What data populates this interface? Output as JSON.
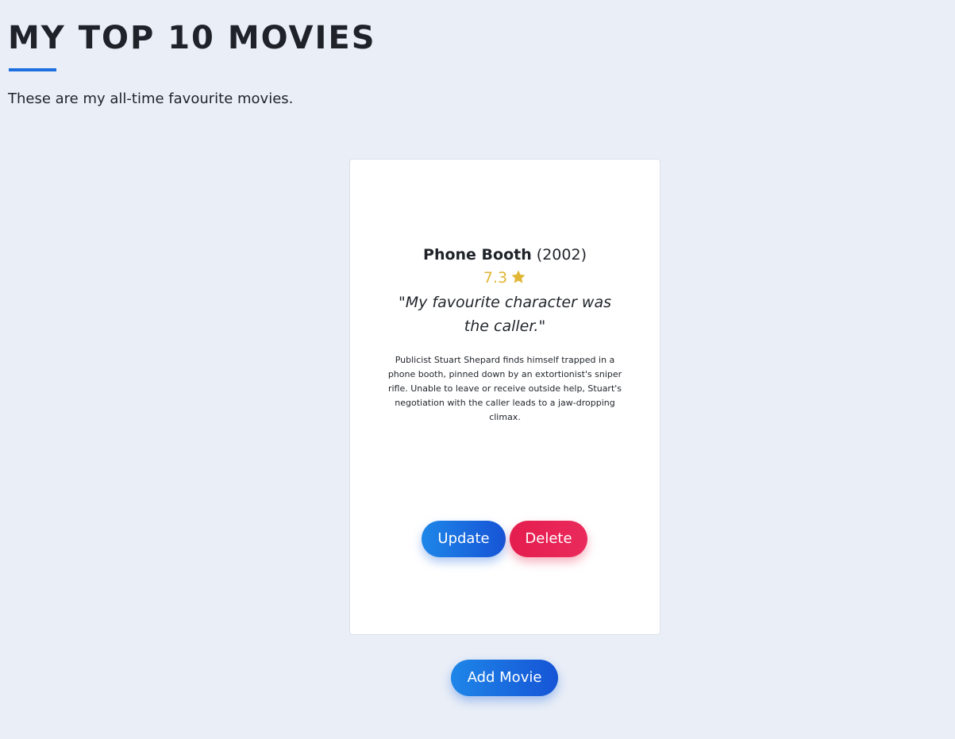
{
  "header": {
    "title": "MY TOP 10 MOVIES",
    "intro": "These are my all-time favourite movies."
  },
  "movie": {
    "title": "Phone Booth",
    "year": "(2002)",
    "rating": "7.3",
    "review": "\"My favourite character was the caller.\"",
    "description": "Publicist Stuart Shepard finds himself trapped in a phone booth, pinned down by an extortionist's sniper rifle. Unable to leave or receive outside help, Stuart's negotiation with the caller leads to a jaw-dropping climax.",
    "update_label": "Update",
    "delete_label": "Delete"
  },
  "actions": {
    "add_label": "Add Movie"
  },
  "icons": {
    "rating": "star-icon"
  },
  "colors": {
    "background": "#e9eef7",
    "accent": "#1e6fe0",
    "rating": "#e1b634",
    "delete": "#e41e4e"
  }
}
